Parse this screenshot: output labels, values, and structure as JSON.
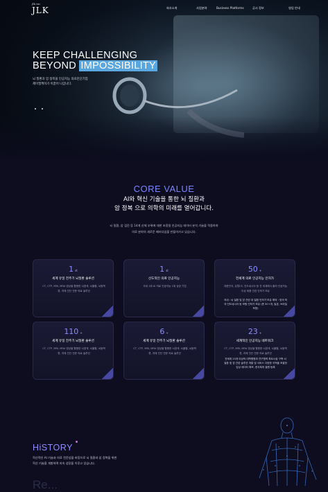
{
  "header": {
    "logo_main": "JLK",
    "logo_small": "jlk inc",
    "nav": [
      "회사소개",
      "사업분야",
      "Business Platforms",
      "공시 정보",
      "영업 안내"
    ]
  },
  "hero": {
    "title_line1": "KEEP CHALLENGING",
    "title_line2_plain": "BEYOND ",
    "title_line2_highlight": "IMPOSSIBILITY",
    "subtitle_line1": "뇌 질환과 암 정복을 인공지능 의료진단기업",
    "subtitle_line2": "제이엘케이가 이끌어 나갑니다.",
    "accent": "#5aa7e0"
  },
  "core": {
    "title": "CORE VALUE",
    "head_line1": "AI와 혁신 기술을 통한 뇌 질환과",
    "head_line2": "암 정복 으로 의학의 미래를 열어갑니다.",
    "desc_line1": "뇌 질환, 암 검진 등 14개 신체 부위에 대한 초정밀 인공지능 데이터 분석 기술을 적용하여",
    "desc_line2": "의료 분야의 새로운 패러다임을 만들어가고 있습니다.",
    "accent": "#7a86ff"
  },
  "cards": [
    {
      "num": "1",
      "unit": "st",
      "title": "세계 유일 전주기 뇌질환 솔루션",
      "desc": "CT, CTP, MRI, MRA 영상을 활용한 뇌경색, 뇌출혈, 뇌동맥류, 치매 진단 전문 의료 솔루션",
      "extra": ""
    },
    {
      "num": "1",
      "unit": "st",
      "title": "선도적인 의료 인공지능",
      "desc": "국내 1위 AI 의료 인공지능 1위 상장 기업",
      "extra": ""
    },
    {
      "num": "50",
      "unit": "+",
      "title": "전세계 의료 인공지능 인허가",
      "desc": "대한민국, 유럽CE, 인도네시아 등 전 세계에서 출허 인공지능 이상 제품 관련 인허가 보유",
      "extra": "국내 : 뇌 질환 및 암 관련 대 질환 인허가 보유 해외 : 영국·미국·인도네시아 등 보험 인허가 보유 (총 50+개, 일본, 브라질 포함)"
    },
    {
      "num": "110",
      "unit": "+",
      "title": "세계 유일 전주기 뇌질환 솔루션",
      "desc": "CT, CTP, MRI, MRA 영상을 활용한 뇌경색, 뇌출혈, 뇌동맥류, 치매 진단 전문 의료 솔루션",
      "extra": ""
    },
    {
      "num": "6",
      "unit": "+",
      "title": "세계 유일 전주기 뇌질환 솔루션",
      "desc": "CT, CTP, MRI, MRA 영상을 활용한 뇌경색, 뇌출혈, 뇌동맥류, 치매 진단 전문 의료 솔루션",
      "extra": ""
    },
    {
      "num": "23",
      "unit": "+",
      "title": "세계적인 인공지능 네트워크",
      "desc": "CT, CTP, MRI, MRA 영상을 활용한 뇌경색, 뇌출혈, 뇌동맥류, 치매 진단 전문 의료 솔루션",
      "extra": "전세계 23개 이상의 대학병원과 연구협력 파트너쉽 구축 뇌 질환 및 암 관련 솔루션 개발 및 서비스 다양한 국적을 포괄한 임상 데이터 확보, 한국특허 출원·등록"
    }
  ],
  "history": {
    "title": "HiSTORY",
    "desc_line1": "혁신적인 AI 기술과 의료 전문성을 바탕으로 뇌 질환과 암 정복을 위한",
    "desc_line2": "혁신 기술을 개발하며 지속 성장을 이루고 있습니다.",
    "next_heading": "Re..."
  }
}
